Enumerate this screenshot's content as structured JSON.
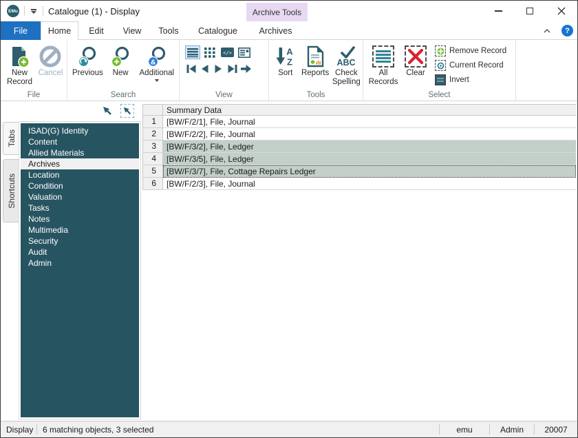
{
  "window": {
    "logo_text": "EMu",
    "title": "Catalogue (1) - Display"
  },
  "contextual_tab_header": "Archive Tools",
  "menu_tabs": {
    "file": "File",
    "home": "Home",
    "edit": "Edit",
    "view": "View",
    "tools": "Tools",
    "catalogue": "Catalogue",
    "archives": "Archives"
  },
  "ribbon": {
    "file_group": {
      "label": "File",
      "new_record": "New Record",
      "cancel": "Cancel"
    },
    "search_group": {
      "label": "Search",
      "previous": "Previous",
      "new": "New",
      "additional": "Additional"
    },
    "view_group": {
      "label": "View"
    },
    "tools_group": {
      "label": "Tools",
      "sort": "Sort",
      "reports": "Reports",
      "check_spelling": "Check Spelling"
    },
    "select_group": {
      "label": "Select",
      "all_records": "All Records",
      "clear": "Clear",
      "remove_record": "Remove Record",
      "current_record": "Current Record",
      "invert": "Invert"
    }
  },
  "icon_glyphs": {
    "ampersand": "&",
    "abc": "ABC",
    "sort_a": "A",
    "sort_z": "Z",
    "code_view": "</>",
    "help": "?"
  },
  "sidebar": {
    "vertical_tabs": {
      "tabs": "Tabs",
      "shortcuts": "Shortcuts"
    },
    "items": [
      "ISAD(G) Identity",
      "Content",
      "Allied Materials",
      "Archives",
      "Location",
      "Condition",
      "Valuation",
      "Tasks",
      "Notes",
      "Multimedia",
      "Security",
      "Audit",
      "Admin"
    ],
    "selected_item": "Archives"
  },
  "table": {
    "header": "Summary Data",
    "rows": [
      {
        "num": "1",
        "text": "[BW/F/2/1], File, Journal",
        "selected": false,
        "focused": false
      },
      {
        "num": "2",
        "text": "[BW/F/2/2], File, Journal",
        "selected": false,
        "focused": false
      },
      {
        "num": "3",
        "text": "[BW/F/3/2], File, Ledger",
        "selected": true,
        "focused": false
      },
      {
        "num": "4",
        "text": "[BW/F/3/5], File, Ledger",
        "selected": true,
        "focused": false
      },
      {
        "num": "5",
        "text": "[BW/F/3/7], File, Cottage Repairs Ledger",
        "selected": true,
        "focused": true
      },
      {
        "num": "6",
        "text": "[BW/F/2/3], File, Journal",
        "selected": false,
        "focused": false
      }
    ]
  },
  "status_bar": {
    "mode": "Display",
    "message": "6 matching objects, 3 selected",
    "server": "emu",
    "user": "Admin",
    "record_id": "20007"
  },
  "colors": {
    "accent_teal": "#2E5D6D",
    "sidebar_teal": "#275461",
    "file_tab_blue": "#1E70C0",
    "contextual_purple": "#E7D9F3",
    "selection_green": "#C3CFC9",
    "disabled_gray": "#9FB0C1",
    "danger_red": "#D8232F",
    "success_green": "#76BC2D",
    "link_blue": "#2F7FD6"
  }
}
